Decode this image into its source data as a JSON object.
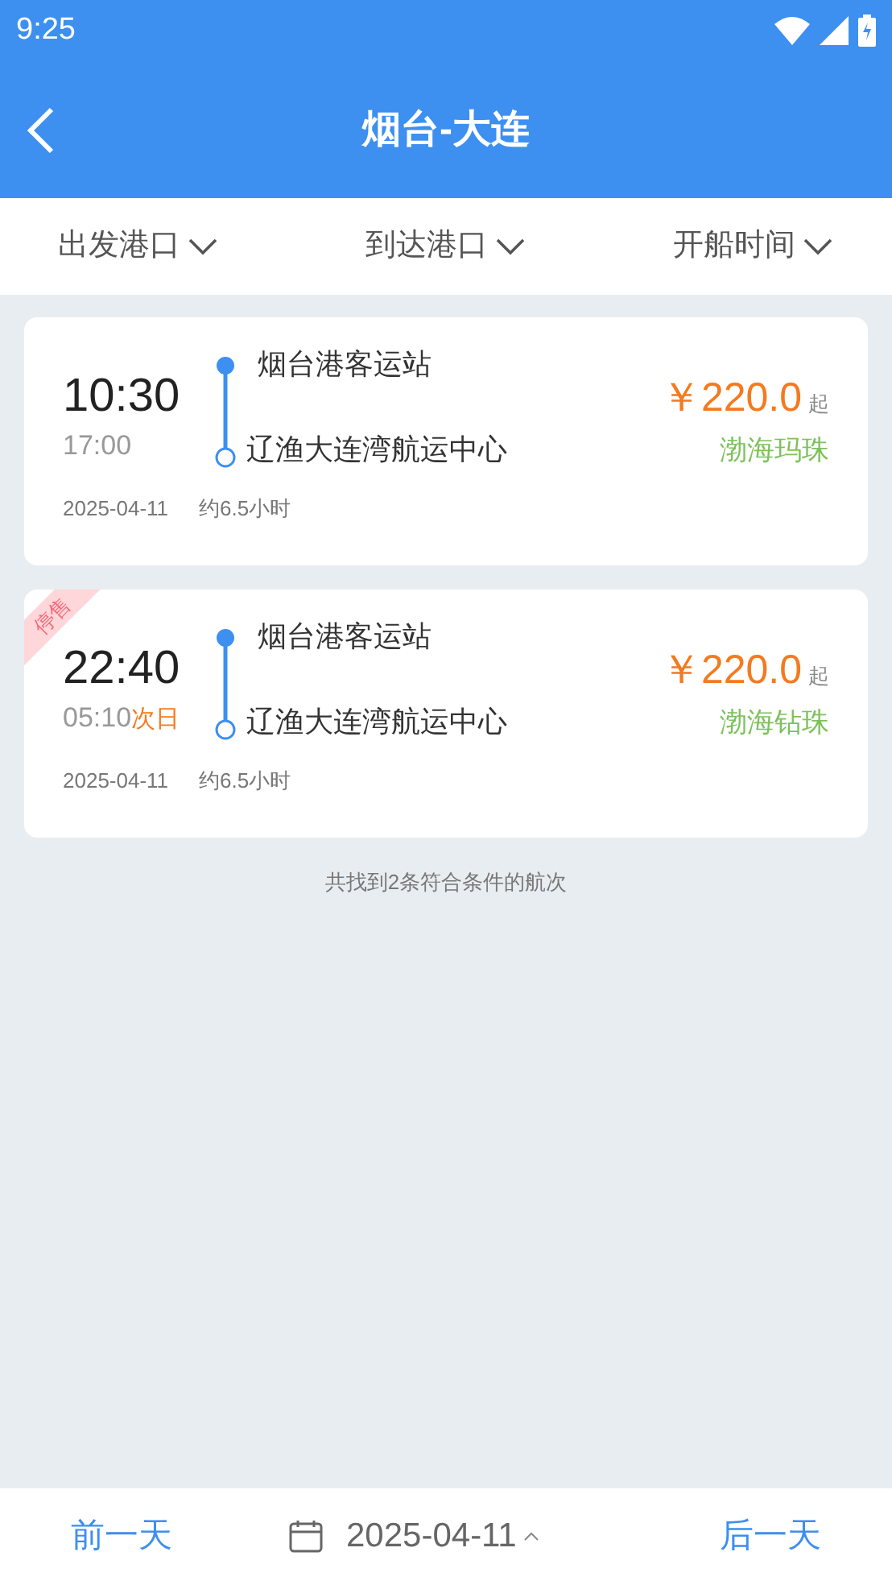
{
  "status_bar": {
    "time": "9:25"
  },
  "header": {
    "title": "烟台-大连"
  },
  "filters": [
    {
      "label": "出发港口"
    },
    {
      "label": "到达港口"
    },
    {
      "label": "开船时间"
    }
  ],
  "trips": [
    {
      "stopped": false,
      "depart": "10:30",
      "arrive": "17:00",
      "from": "烟台港客运站",
      "to": "辽渔大连湾航运中心",
      "price": "￥220.0",
      "price_suffix": "起",
      "ship": "渤海玛珠",
      "date": "2025-04-11",
      "duration": "约6.5小时"
    },
    {
      "stopped": true,
      "stop_label": "停售",
      "depart": "22:40",
      "arrive": "05:10",
      "next_day": "次日",
      "from": "烟台港客运站",
      "to": "辽渔大连湾航运中心",
      "price": "￥220.0",
      "price_suffix": "起",
      "ship": "渤海钻珠",
      "date": "2025-04-11",
      "duration": "约6.5小时"
    }
  ],
  "summary": "共找到2条符合条件的航次",
  "bottom_bar": {
    "prev": "前一天",
    "date": "2025-04-11",
    "next": "后一天"
  }
}
